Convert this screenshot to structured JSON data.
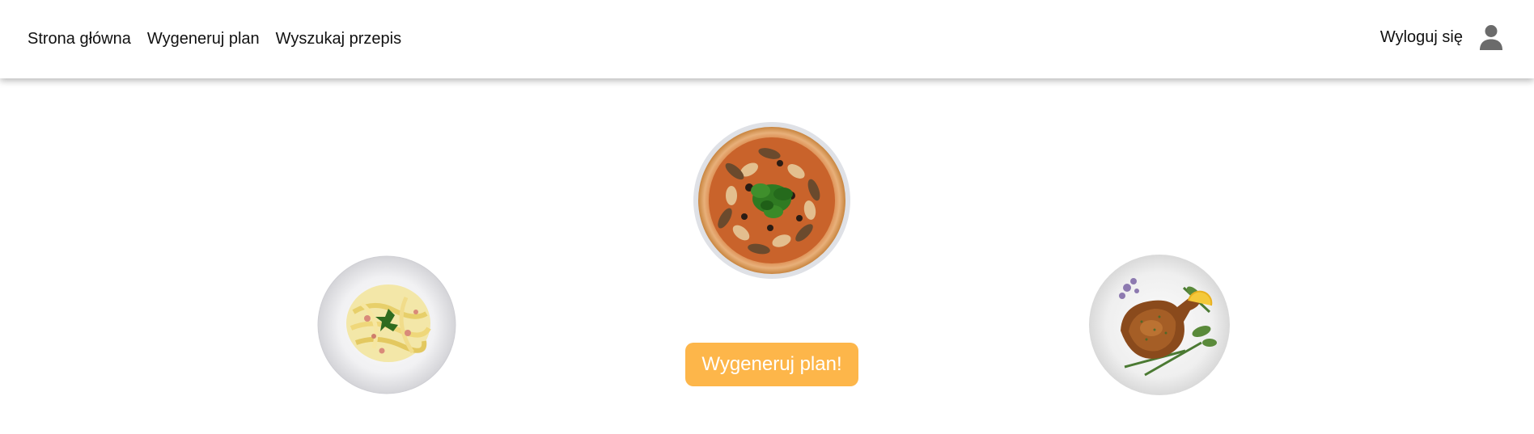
{
  "nav": {
    "links": [
      {
        "label": "Strona główna"
      },
      {
        "label": "Wygeneruj plan"
      },
      {
        "label": "Wyszukaj przepis"
      }
    ],
    "logout_label": "Wyloguj się",
    "user_icon": "user-icon"
  },
  "hero": {
    "generate_button_label": "Wygeneruj plan!",
    "images": [
      "pasta-dish-image",
      "pizza-dish-image",
      "roast-chicken-dish-image"
    ]
  },
  "colors": {
    "button_bg": "#fdb64a",
    "button_text": "#ffffff",
    "nav_text": "#111111",
    "icon": "#6b6b6b"
  }
}
